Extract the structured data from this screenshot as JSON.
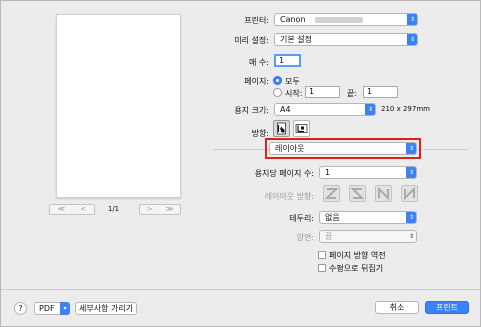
{
  "printer": {
    "label": "프린터:",
    "value": "Canon"
  },
  "presets": {
    "label": "미리 설정:",
    "value": "기본 설정"
  },
  "copies": {
    "label": "매 수:",
    "value": "1"
  },
  "pages": {
    "label": "페이지:",
    "all_label": "모두",
    "from_label": "시작:",
    "from_value": "1",
    "to_label": "끝:",
    "to_value": "1"
  },
  "paper_size": {
    "label": "용지 크기:",
    "value": "A4",
    "dimensions": "210 x 297mm"
  },
  "orientation": {
    "label": "방향:"
  },
  "section_menu": {
    "value": "레이아웃"
  },
  "layout": {
    "pages_per_sheet_label": "용지당 페이지 수:",
    "pages_per_sheet_value": "1",
    "direction_label": "레이아웃 방향:",
    "border_label": "테두리:",
    "border_value": "없음",
    "two_sided_label": "양면:",
    "two_sided_value": "끔",
    "reverse_label": "페이지 방향 역전",
    "flip_label": "수평으로 뒤집기"
  },
  "preview": {
    "page_indicator": "1/1",
    "prev_first": "≪",
    "prev": "<",
    "next": ">",
    "last": "≫"
  },
  "footer": {
    "help": "?",
    "pdf_label": "PDF",
    "details_label": "세부사항 가리기",
    "cancel_label": "취소",
    "print_label": "프린트"
  },
  "colors": {
    "accent": "#3b82f6",
    "highlight_border": "#e02020"
  }
}
